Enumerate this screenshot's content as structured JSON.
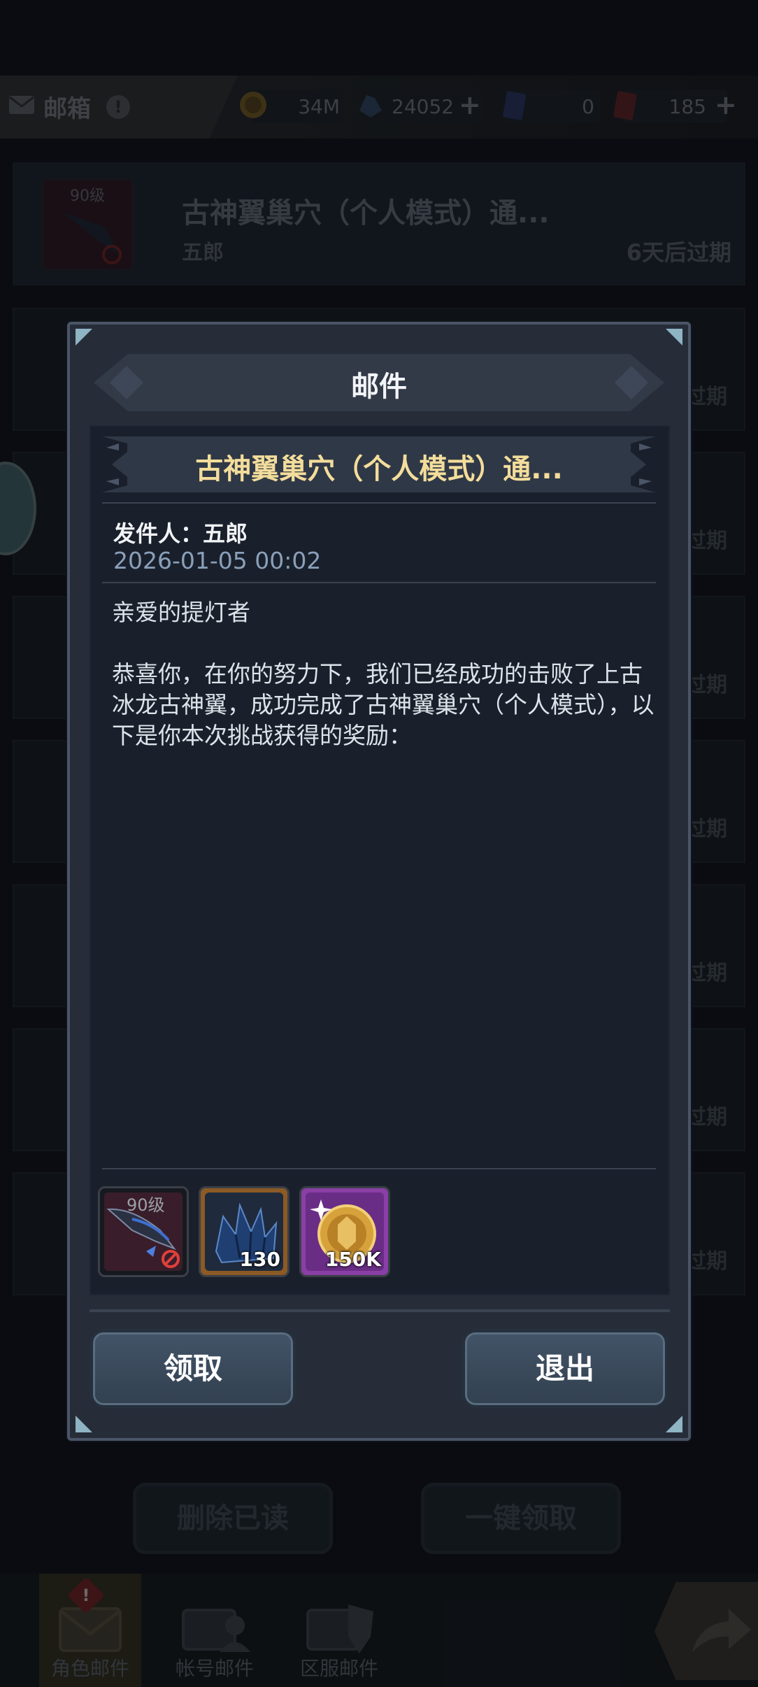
{
  "header": {
    "title": "邮箱",
    "warn_glyph": "!"
  },
  "resources": {
    "gold": "34M",
    "crystal": "24052",
    "card": "0",
    "gold_ticket": "185"
  },
  "mail_list": [
    {
      "level_tag": "90级",
      "title": "古神翼巢穴（个人模式）通...",
      "sender": "五郎",
      "expiry": "6天后过期"
    },
    {
      "expiry": "过期"
    },
    {
      "expiry": "过期"
    },
    {
      "expiry": "过期"
    },
    {
      "expiry": "过期"
    },
    {
      "expiry": "过期"
    },
    {
      "expiry": "过期"
    },
    {
      "expiry": "过期"
    }
  ],
  "bottom_actions": {
    "delete_read": "删除已读",
    "claim_all": "一键领取"
  },
  "nav": {
    "role_mail": "角色邮件",
    "account_mail": "帐号邮件",
    "server_mail": "区服邮件",
    "badge": "!"
  },
  "dialog": {
    "title": "邮件",
    "subject": "古神翼巢穴（个人模式）通...",
    "sender_label": "发件人：",
    "sender": "五郎",
    "date": "2026-01-05 00:02",
    "greeting": "亲爱的提灯者",
    "body": "恭喜你，在你的努力下，我们已经成功的击败了上古冰龙古神翼，成功完成了古神翼巢穴（个人模式），以下是你本次挑战获得的奖励：",
    "rewards": [
      {
        "level_tag": "90级",
        "amount": ""
      },
      {
        "amount": "130"
      },
      {
        "amount": "150K"
      }
    ],
    "claim_label": "领取",
    "exit_label": "退出"
  },
  "colors": {
    "subject_text": "#f3dd9b",
    "date_text": "#8aa0bb",
    "button_bg": "#3a4a5c"
  }
}
